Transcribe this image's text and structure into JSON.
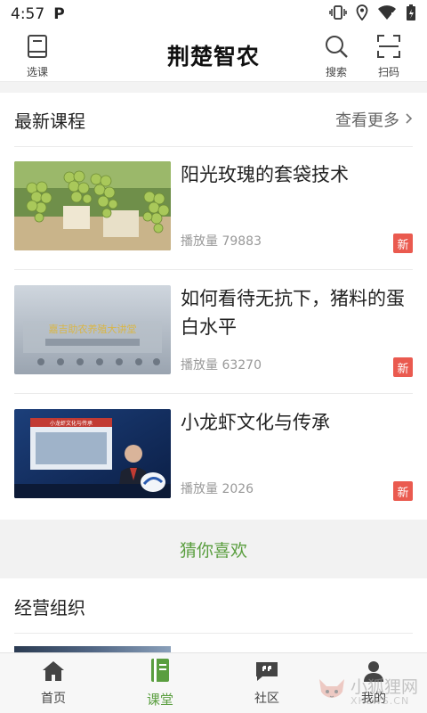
{
  "status": {
    "time": "4:57",
    "p_badge": "P"
  },
  "header": {
    "title": "荆楚智农",
    "left_label": "选课",
    "search_label": "搜索",
    "scan_label": "扫码"
  },
  "latest": {
    "title": "最新课程",
    "more": "查看更多",
    "courses": [
      {
        "title": "阳光玫瑰的套袋技术",
        "plays": "播放量 79883",
        "badge": "新"
      },
      {
        "title": "如何看待无抗下，猪料的蛋白水平",
        "plays": "播放量 63270",
        "badge": "新",
        "thumb_caption": "嘉吉助农养殖大讲堂"
      },
      {
        "title": "小龙虾文化与传承",
        "plays": "播放量 2026",
        "badge": "新",
        "thumb_caption": "小龙虾文化与传承"
      }
    ]
  },
  "guess": {
    "label": "猜你喜欢"
  },
  "org": {
    "title": "经营组织"
  },
  "nav": {
    "items": [
      {
        "label": "首页",
        "icon": "home-icon"
      },
      {
        "label": "课堂",
        "icon": "book-icon",
        "active": true
      },
      {
        "label": "社区",
        "icon": "chat-quote-icon"
      },
      {
        "label": "我的",
        "icon": "user-icon"
      }
    ]
  },
  "watermark": {
    "cn": "小狐狸网",
    "en": "XHLWS.CN"
  },
  "colors": {
    "accent": "#5a9e3f",
    "new_badge": "#ea5a4f"
  }
}
